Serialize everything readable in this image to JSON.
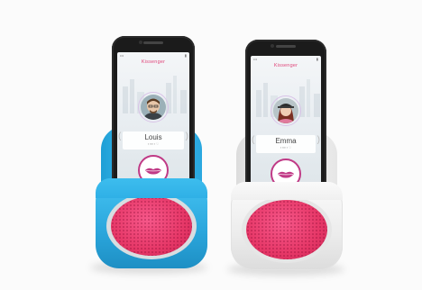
{
  "scene": {
    "description_colors": {
      "blue_base": "#33b5e9",
      "white_base": "#f2f2f2",
      "speaker_pink": "#ec3d6e",
      "phone_black": "#1b1b1b",
      "accent_purple": "#c03a86"
    }
  },
  "left_phone": {
    "app_title": "Kissenger",
    "contact_name": "Louis"
  },
  "right_phone": {
    "app_title": "Kissenger",
    "contact_name": "Emma"
  }
}
